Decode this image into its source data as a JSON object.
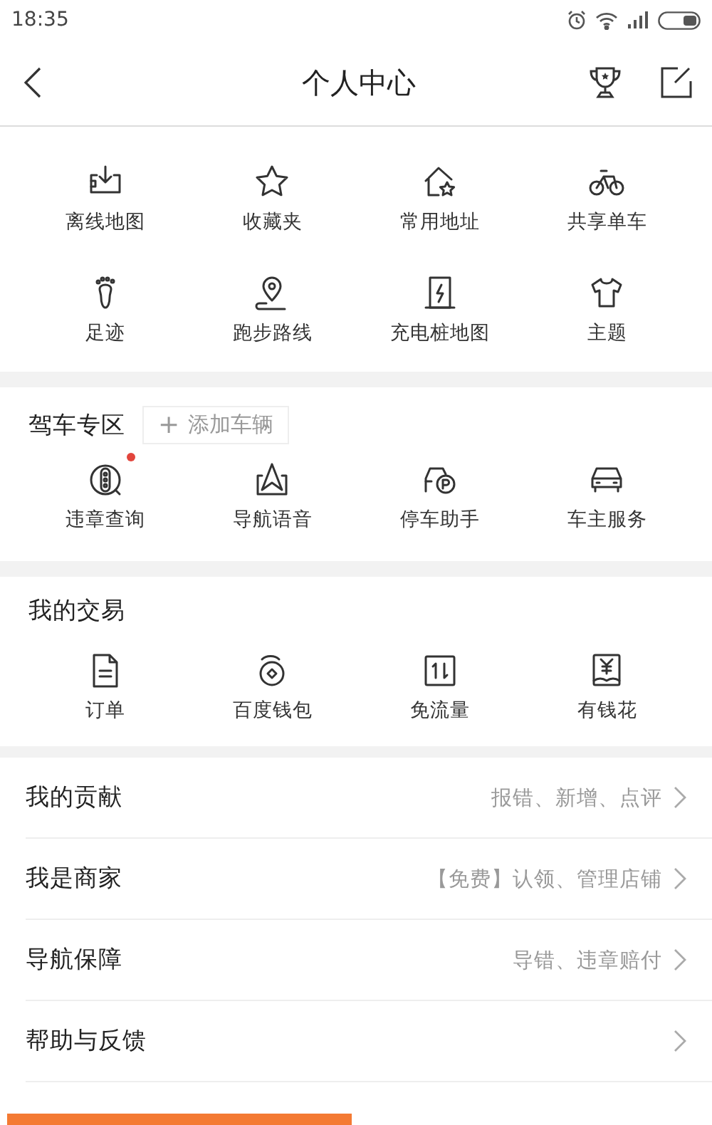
{
  "status_bar": {
    "time": "18:35"
  },
  "header": {
    "title": "个人中心"
  },
  "common": {
    "items": [
      {
        "label": "离线地图"
      },
      {
        "label": "收藏夹"
      },
      {
        "label": "常用地址"
      },
      {
        "label": "共享单车"
      },
      {
        "label": "足迹"
      },
      {
        "label": "跑步路线"
      },
      {
        "label": "充电桩地图"
      },
      {
        "label": "主题"
      }
    ]
  },
  "driving": {
    "title": "驾车专区",
    "add_button": {
      "icon": "+",
      "label": "添加车辆"
    },
    "items": [
      {
        "label": "违章查询",
        "dot": true
      },
      {
        "label": "导航语音",
        "dot": false
      },
      {
        "label": "停车助手",
        "dot": false
      },
      {
        "label": "车主服务",
        "dot": false
      }
    ]
  },
  "trade": {
    "title": "我的交易",
    "items": [
      {
        "label": "订单"
      },
      {
        "label": "百度钱包"
      },
      {
        "label": "免流量"
      },
      {
        "label": "有钱花"
      }
    ]
  },
  "list": [
    {
      "title": "我的贡献",
      "detail": "报错、新增、点评"
    },
    {
      "title": "我是商家",
      "detail": "【免费】认领、管理店铺"
    },
    {
      "title": "导航保障",
      "detail": "导错、违章赔付"
    },
    {
      "title": "帮助与反馈"
    }
  ]
}
